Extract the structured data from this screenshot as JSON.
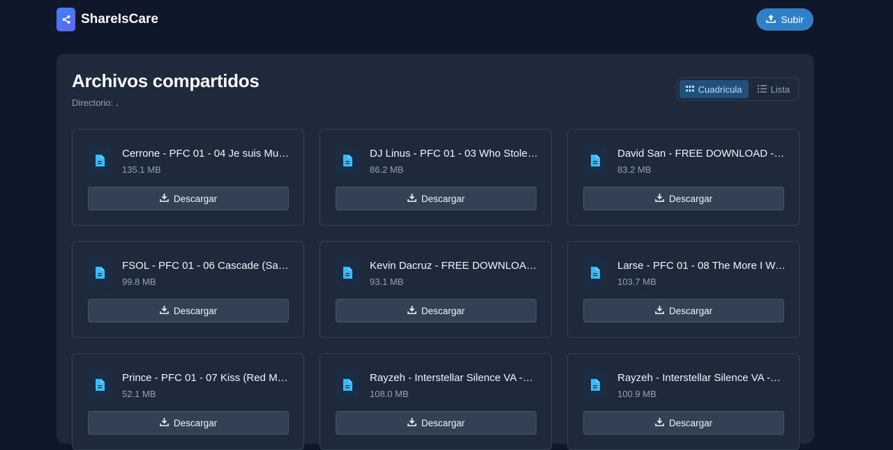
{
  "app": {
    "name": "ShareIsCare",
    "upload_label": "Subir"
  },
  "page": {
    "title": "Archivos compartidos",
    "directory_label": "Directorio:",
    "directory_value": ".",
    "view_grid_label": "Cuadrícula",
    "view_list_label": "Lista",
    "active_view": "grid"
  },
  "files": [
    {
      "name": "Cerrone - PFC 01 - 04 Je suis Mus...",
      "size": "135.1 MB",
      "download_label": "Descargar"
    },
    {
      "name": "DJ Linus - PFC 01 - 03 Who Stole ...",
      "size": "86.2 MB",
      "download_label": "Descargar"
    },
    {
      "name": "David San - FREE DOWNLOAD - D...",
      "size": "83.2 MB",
      "download_label": "Descargar"
    },
    {
      "name": "FSOL - PFC 01 - 06 Cascade (Sas...",
      "size": "99.8 MB",
      "download_label": "Descargar"
    },
    {
      "name": "Kevin Dacruz - FREE DOWNLOAD ...",
      "size": "93.1 MB",
      "download_label": "Descargar"
    },
    {
      "name": "Larse - PFC 01 - 08 The More I Wa...",
      "size": "103.7 MB",
      "download_label": "Descargar"
    },
    {
      "name": "Prince - PFC 01 - 07 Kiss (Red Me...",
      "size": "52.1 MB",
      "download_label": "Descargar"
    },
    {
      "name": "Rayzeh - Interstellar Silence VA -R...",
      "size": "108.0 MB",
      "download_label": "Descargar"
    },
    {
      "name": "Rayzeh - Interstellar Silence VA -R...",
      "size": "100.9 MB",
      "download_label": "Descargar"
    }
  ],
  "colors": {
    "background": "#0f172a",
    "panel": "#1e293b",
    "accent": "#2f80c9",
    "file_icon": "#38bdf8"
  },
  "icons": {
    "logo": "share-icon",
    "upload": "upload-icon",
    "grid": "grid-icon",
    "list": "list-icon",
    "file": "file-icon",
    "download": "download-icon"
  }
}
